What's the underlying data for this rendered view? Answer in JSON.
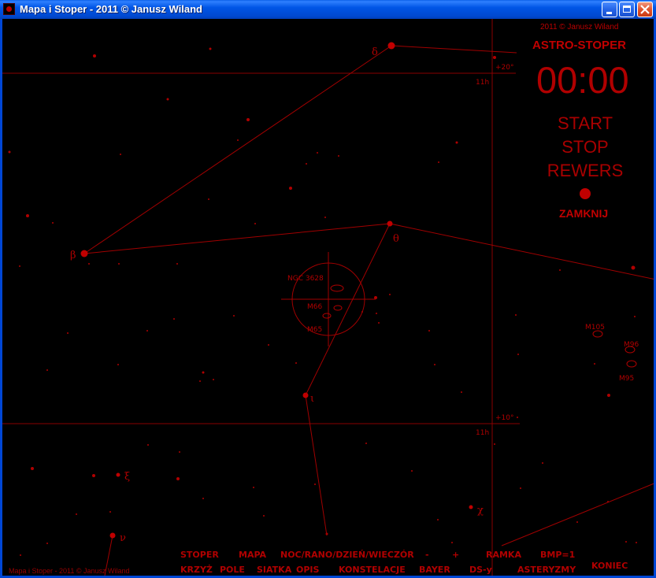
{
  "window": {
    "title": "Mapa i Stoper - 2011 © Janusz Wiland",
    "buttons": [
      "minimize",
      "maximize",
      "close"
    ]
  },
  "stopwatch": {
    "credit": "2011 © Janusz Wiland",
    "title": "ASTRO-STOPER",
    "time": "00:00",
    "start_label": "START",
    "stop_label": "STOP",
    "reverse_label": "REWERS",
    "close_label": "ZAMKNIJ"
  },
  "map": {
    "grid_labels": {
      "dec_top": "+20°",
      "ra_top": "11h",
      "dec_bottom": "+10°",
      "ra_bottom": "11h"
    },
    "star_labels": {
      "delta": "δ",
      "beta": "β",
      "theta": "θ",
      "iota": "ι",
      "xi": "ξ",
      "nu": "ν",
      "chi": "χ"
    },
    "objects": {
      "ngc3628": "NGC 3628",
      "m66": "M66",
      "m65": "M65",
      "m105": "M105",
      "m96": "M96",
      "m95": "M95"
    }
  },
  "menu": {
    "row1": {
      "stoper": "STOPER",
      "mapa": "MAPA",
      "mode": "NOC/RANO/DZIEŃ/WIECZÓR",
      "minus": "-",
      "plus": "+",
      "ramka": "RAMKA",
      "bmp": "BMP=1"
    },
    "row2": {
      "krzyz": "KRZYŻ",
      "pole": "POLE",
      "siatka": "SIATKA",
      "opis": "OPIS",
      "konstelacje": "KONSTELACJE",
      "bayer": "BAYER",
      "ds": "DS-y",
      "asteryzmy": "ASTERYZMY"
    },
    "koniec": "KONIEC"
  },
  "footer": {
    "credit": "Mapa i Stoper - 2011 © Janusz Wiland"
  },
  "colors": {
    "background": "#000000",
    "accent_red": "#c00000",
    "titlebar_blue": "#0055e5"
  }
}
